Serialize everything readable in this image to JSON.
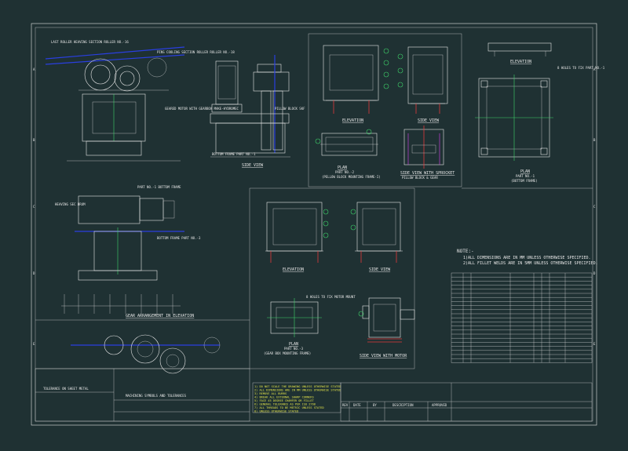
{
  "views": {
    "side_view": "SIDE VIEW",
    "elevation_top": "ELEVATION",
    "side_view_top": "SIDE VIEW",
    "plan_frame1": [
      "PLAN",
      "PART NO.-2",
      "(PELLOW BLOCK MOUNTING FRAME-I)"
    ],
    "side_view_sprocket": [
      "SIDE VIEW WITH SPROCKET",
      "PILLOW BLOCK & GEAR"
    ],
    "elevation_right": "ELEVATION",
    "plan_bottom": [
      "PLAN",
      "PART NO.-1",
      "(BOTTOM FRAME)"
    ],
    "elevation_mid": "ELEVATION",
    "side_view_mid": "SIDE VIEW",
    "plan_gearbox": [
      "PLAN",
      "PART NO.-3",
      "(GEAR BOX MOUNTING FRAME)"
    ],
    "side_view_motor": "SIDE VIEW WITH MOTOR",
    "gear_arrangement": "GEAR ARRANGEMENT IN ELEVATION"
  },
  "callouts": {
    "c1": "LAST ROLLER HEAVING SECTION ROLLER NO.-16",
    "c2": "PINS COOLING SECTION ROLLER ROLLER NO.-18",
    "c3": "GEARED MOTOR WITH GEARBOX MAKE-HYDROMEC",
    "c4": "PILLOW BLOCK SKF",
    "c5": "BOTTOM FRAME PART NO.-1",
    "c6": "PART NO.-1 BOTTOM FRAME",
    "c7": "HEAVING SEC DRUM",
    "c8": "BOTTOM FRAME PART NO.-3",
    "c9": "8 HOLES TO FIX MOTOR MOUNT",
    "c10": "8 HOLES TO FIX PART NO.-1"
  },
  "notes": {
    "heading": "NOTE:-",
    "lines": [
      "1)ALL DIMENSIONS ARE IN MM UNLESS OTHERWISE SPECIFIED.",
      "2)ALL FILLET WELDS ARE IN 5MM UNLESS OTHERWISE SPECIFIED."
    ]
  },
  "yellow_notes": [
    "1) DO NOT SCALE THE DRAWING UNLESS OTHERWISE STATED",
    "2) ALL DIMENSIONS ARE IN MM UNLESS OTHERWISE STATED",
    "3) REMOVE ALL BURRS",
    "4) BREAK ALL EXTERNAL SHARP CORNERS",
    "5) FACE 45 DEGREE CHAMFER OR FILLET",
    "6) GENERAL TOLERANCE AS PER ISO 2768",
    "7) ALL THREADS TO BE METRIC UNLESS STATED",
    "8) UNLESS OTHERWISE STATED"
  ],
  "symbols_title": "MACHINING SYMBOLS AND TOLERANCES",
  "tolerance_title": "TOLERANCE ON SHEET METAL",
  "revision_header": [
    "REV",
    "DATE",
    "BY",
    "DESCRIPTION",
    "APPROVED"
  ]
}
